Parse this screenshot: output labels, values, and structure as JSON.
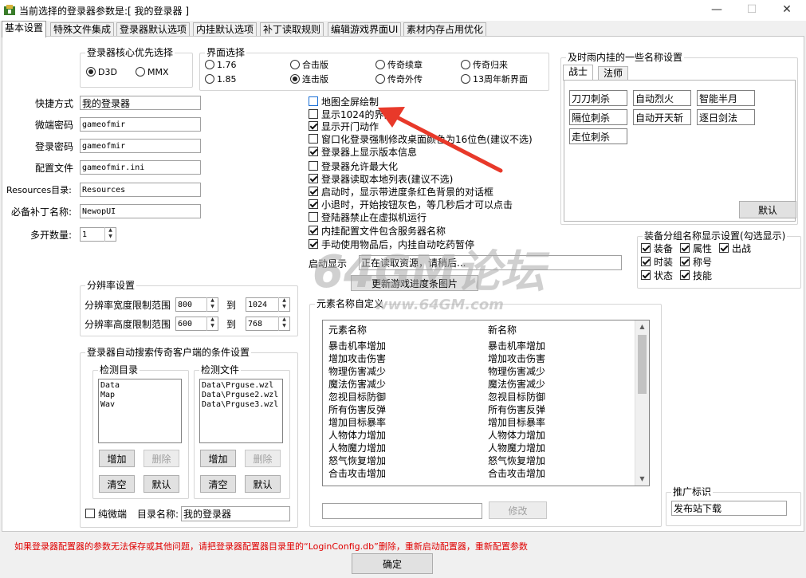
{
  "window": {
    "title": "当前选择的登录器参数是:[ 我的登录器 ]",
    "minimize": "—",
    "maximize": "☐",
    "close": "✕"
  },
  "tabs": [
    "基本设置",
    "特殊文件集成",
    "登录器默认选项",
    "内挂默认选项",
    "补丁读取规则",
    "编辑游戏界面UI",
    "素材内存占用优化"
  ],
  "core_priority": {
    "title": "登录器核心优先选择",
    "options": [
      {
        "label": "D3D",
        "selected": true
      },
      {
        "label": "MMX",
        "selected": false
      }
    ]
  },
  "interface": {
    "title": "界面选择",
    "options": [
      {
        "label": "1.76",
        "selected": false
      },
      {
        "label": "合击版",
        "selected": false
      },
      {
        "label": "传奇续章",
        "selected": false
      },
      {
        "label": "传奇归来",
        "selected": false
      },
      {
        "label": "1.85",
        "selected": false
      },
      {
        "label": "连击版",
        "selected": true
      },
      {
        "label": "传奇外传",
        "selected": false
      },
      {
        "label": "13周年新界面",
        "selected": false
      }
    ]
  },
  "fields": [
    {
      "label": "快捷方式",
      "value": "我的登录器"
    },
    {
      "label": "微端密码",
      "value": "gameofmir"
    },
    {
      "label": "登录密码",
      "value": "gameofmir"
    },
    {
      "label": "配置文件",
      "value": "gameofmir.ini"
    },
    {
      "label": "Resources目录:",
      "value": "Resources"
    },
    {
      "label": "必备补丁名称:",
      "value": "NewopUI"
    }
  ],
  "multi_open": {
    "label": "多开数量:",
    "value": "1"
  },
  "checkboxes": [
    {
      "label": "地图全屏绘制",
      "checked": false
    },
    {
      "label": "显示1024的界面",
      "checked": false
    },
    {
      "label": "显示开门动作",
      "checked": true
    },
    {
      "label": "窗口化登录强制修改桌面颜色为16位色(建议不选)",
      "checked": false
    },
    {
      "label": "登录器上显示版本信息",
      "checked": true
    },
    {
      "label": "登录器允许最大化",
      "checked": false
    },
    {
      "label": "登录器读取本地列表(建议不选)",
      "checked": true
    },
    {
      "label": "启动时，显示带进度条红色背景的对话框",
      "checked": true
    },
    {
      "label": "小退时，开始按钮灰色，等几秒后才可以点击",
      "checked": true
    },
    {
      "label": "登陆器禁止在虚拟机运行",
      "checked": false
    },
    {
      "label": "内挂配置文件包含服务器名称",
      "checked": true
    },
    {
      "label": "手动使用物品后，内挂自动吃药暂停",
      "checked": true
    }
  ],
  "launch_display": {
    "label": "启动显示",
    "value": "正在读取资源，请稍后..."
  },
  "batch_button": "更新游戏进度条图片",
  "resolution": {
    "title": "分辨率设置",
    "width_label": "分辨率宽度限制范围",
    "height_label": "分辨率高度限制范围",
    "to": "到",
    "width_min": "800",
    "width_max": "1024",
    "height_min": "600",
    "height_max": "768"
  },
  "search_group": {
    "title": "登录器自动搜索传奇客户端的条件设置",
    "dir_title": "检测目录",
    "dirs": [
      "Data",
      "Map",
      "Wav"
    ],
    "file_title": "检测文件",
    "files": [
      "Data\\Prguse.wzl",
      "Data\\Prguse2.wzl",
      "Data\\Prguse3.wzl"
    ],
    "add": "增加",
    "delete": "删除",
    "clear": "清空",
    "default": "默认",
    "pure_micro": "纯微端",
    "dir_name_label": "目录名称:",
    "dir_name_value": "我的登录器"
  },
  "element_names": {
    "title": "元素名称自定义",
    "col_element": "元素名称",
    "col_new": "新名称",
    "rows": [
      [
        "暴击机率增加",
        "暴击机率增加"
      ],
      [
        "增加攻击伤害",
        "增加攻击伤害"
      ],
      [
        "物理伤害减少",
        "物理伤害减少"
      ],
      [
        "魔法伤害减少",
        "魔法伤害减少"
      ],
      [
        "忽视目标防御",
        "忽视目标防御"
      ],
      [
        "所有伤害反弹",
        "所有伤害反弹"
      ],
      [
        "增加目标暴率",
        "增加目标暴率"
      ],
      [
        "人物体力增加",
        "人物体力增加"
      ],
      [
        "人物魔力增加",
        "人物魔力增加"
      ],
      [
        "怒气恢复增加",
        "怒气恢复增加"
      ],
      [
        "合击攻击增加",
        "合击攻击增加"
      ]
    ],
    "modify": "修改"
  },
  "skill_names": {
    "title": "及时雨内挂的一些名称设置",
    "tabs": [
      "战士",
      "法师"
    ],
    "items": [
      "刀刀刺杀",
      "自动烈火",
      "智能半月",
      "隔位刺杀",
      "自动开天斩",
      "逐日剑法",
      "走位刺杀"
    ],
    "default": "默认"
  },
  "equip_group": {
    "title": "装备分组名称显示设置(勾选显示)",
    "items": [
      {
        "label": "装备",
        "checked": true
      },
      {
        "label": "属性",
        "checked": true
      },
      {
        "label": "出战",
        "checked": true
      },
      {
        "label": "时装",
        "checked": true
      },
      {
        "label": "称号",
        "checked": true
      },
      {
        "label": "状态",
        "checked": true
      },
      {
        "label": "技能",
        "checked": true
      }
    ]
  },
  "promo": {
    "title": "推广标识",
    "value": "发布站下载"
  },
  "footer": {
    "warning": "如果登录器配置器的参数无法保存或其他问题，请把登录器配置器目录里的“LoginConfig.db”删除，重新启动配置器，重新配置参数",
    "ok": "确定"
  },
  "watermark": {
    "big": "64GM论坛",
    "small": "www.64GM.com"
  },
  "colors": {
    "accent": "#1a6fd6",
    "warning": "#e00000",
    "arrow": "#e8392a"
  }
}
